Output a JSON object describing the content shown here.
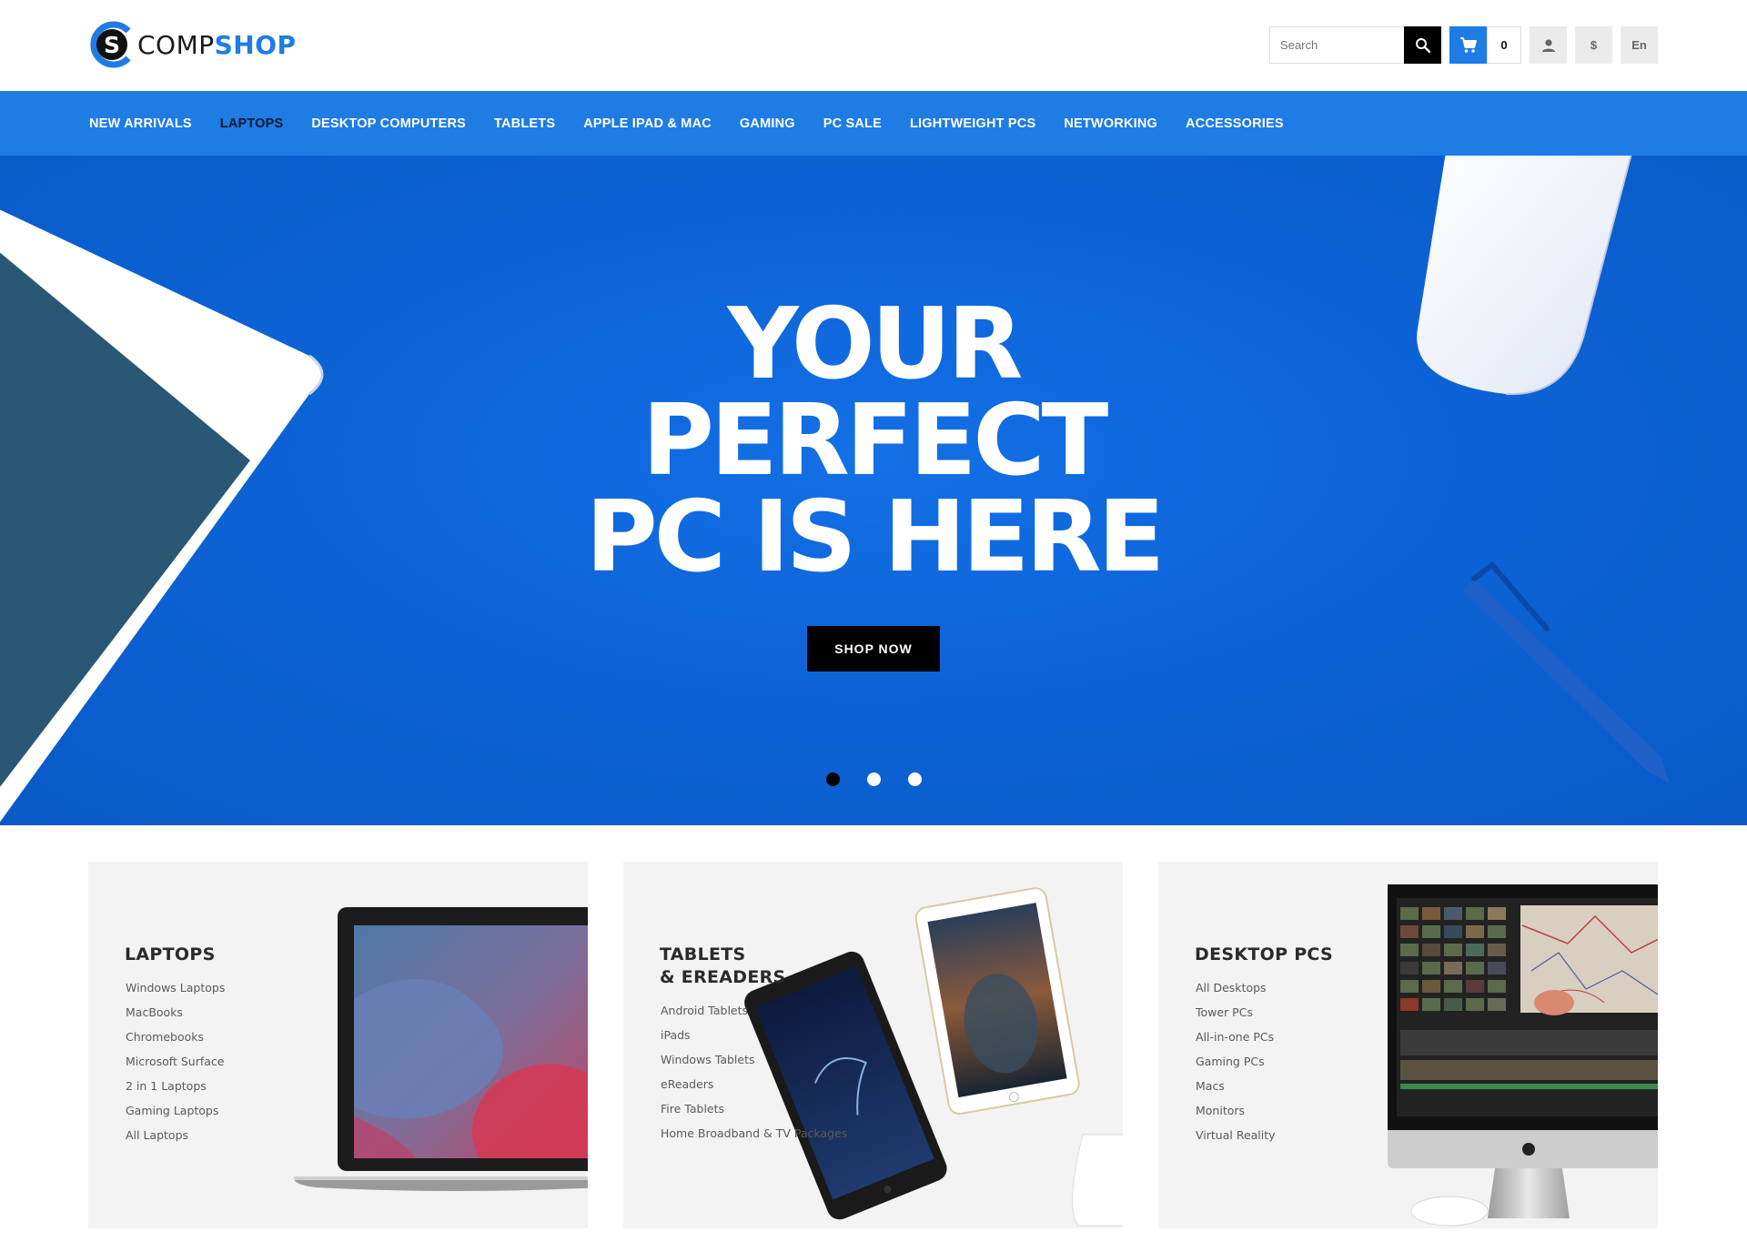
{
  "brand": {
    "part1": "COMP",
    "part2": "SHOP",
    "mark_letter": "S"
  },
  "header": {
    "search_placeholder": "Search",
    "cart_count": "0",
    "currency": "$",
    "language": "En"
  },
  "nav": {
    "items": [
      {
        "label": "NEW ARRIVALS"
      },
      {
        "label": "LAPTOPS"
      },
      {
        "label": "DESKTOP COMPUTERS"
      },
      {
        "label": "TABLETS"
      },
      {
        "label": "APPLE IPAD & MAC"
      },
      {
        "label": "GAMING"
      },
      {
        "label": "PC SALE"
      },
      {
        "label": "LIGHTWEIGHT PCS"
      },
      {
        "label": "NETWORKING"
      },
      {
        "label": "ACCESSORIES"
      }
    ],
    "active_index": 1
  },
  "hero": {
    "line1": "YOUR",
    "line2": "PERFECT",
    "line3": "PC IS HERE",
    "cta": "SHOP NOW",
    "slides_total": 3,
    "active_slide": 1
  },
  "categories": [
    {
      "title_line1": "LAPTOPS",
      "title_line2": "",
      "links": [
        "Windows Laptops",
        "MacBooks",
        "Chromebooks",
        "Microsoft Surface",
        "2 in 1 Laptops",
        "Gaming Laptops",
        "All Laptops"
      ]
    },
    {
      "title_line1": "TABLETS",
      "title_line2": "& EREADERS",
      "links": [
        "Android Tablets",
        "iPads",
        "Windows Tablets",
        "eReaders",
        "Fire Tablets",
        "Home Broadband & TV Packages"
      ]
    },
    {
      "title_line1": "DESKTOP PCS",
      "title_line2": "",
      "links": [
        "All Desktops",
        "Tower PCs",
        "All-in-one PCs",
        "Gaming PCs",
        "Macs",
        "Monitors",
        "Virtual Reality"
      ]
    }
  ],
  "colors": {
    "brand_blue": "#1e7ce4",
    "hero_blue": "#0c63d6",
    "black": "#000000",
    "card_bg": "#f3f3f3"
  }
}
